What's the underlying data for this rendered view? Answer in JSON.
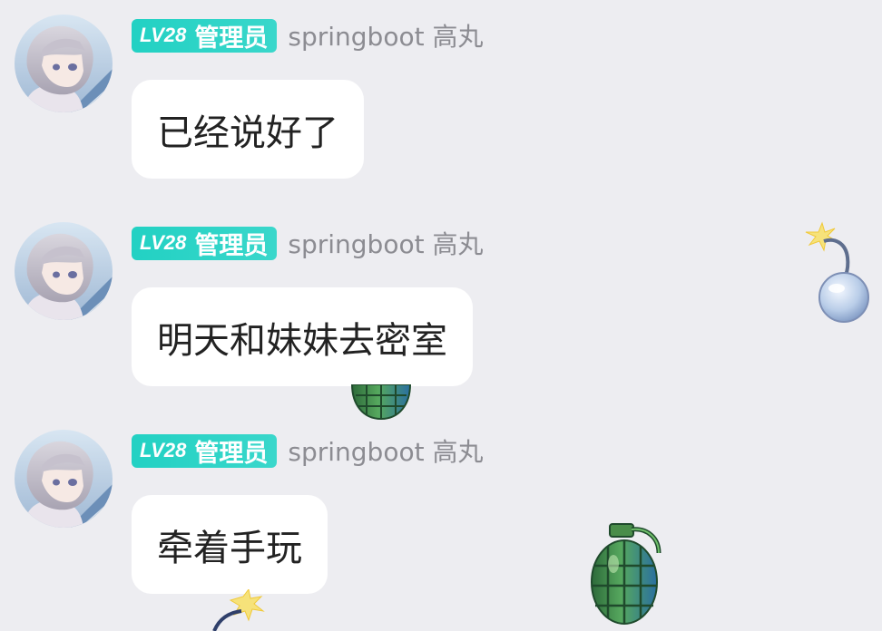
{
  "messages": [
    {
      "level": "LV28",
      "role": "管理员",
      "username": "springboot 高丸",
      "text": "已经说好了"
    },
    {
      "level": "LV28",
      "role": "管理员",
      "username": "springboot 高丸",
      "text": "明天和妹妹去密室"
    },
    {
      "level": "LV28",
      "role": "管理员",
      "username": "springboot 高丸",
      "text": "牵着手玩"
    }
  ],
  "colors": {
    "background": "#ededf1",
    "badge": "#22d1c3",
    "username": "#8c8c92",
    "bubble": "#ffffff",
    "text": "#222222"
  },
  "icons": {
    "avatar": "anime-avatar",
    "bomb": "bomb-icon",
    "grenade": "grenade-icon"
  }
}
